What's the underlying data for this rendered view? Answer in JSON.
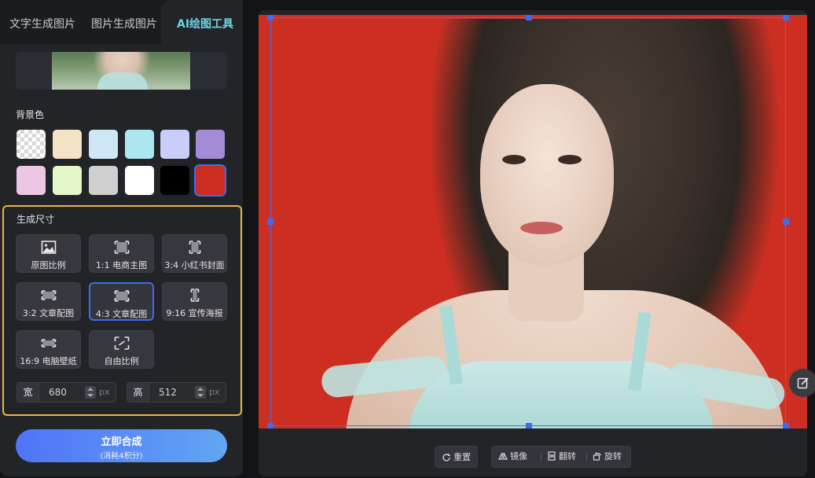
{
  "tabs": [
    {
      "label": "文字生成图片"
    },
    {
      "label": "图片生成图片"
    },
    {
      "label": "AI绘图工具"
    }
  ],
  "background_color": {
    "label": "背景色",
    "swatches": [
      {
        "name": "transparent",
        "color": "transparent"
      },
      {
        "name": "cream",
        "color": "#f3e2c4"
      },
      {
        "name": "light-blue",
        "color": "#cfe6f6"
      },
      {
        "name": "cyan",
        "color": "#ace6ef"
      },
      {
        "name": "lavender",
        "color": "#c8cdfa"
      },
      {
        "name": "purple",
        "color": "#a38bd6"
      },
      {
        "name": "pink",
        "color": "#ecc7e5"
      },
      {
        "name": "light-green",
        "color": "#e3f7c9"
      },
      {
        "name": "gray",
        "color": "#cfcfd0"
      },
      {
        "name": "white",
        "color": "#ffffff"
      },
      {
        "name": "black",
        "color": "#000000"
      },
      {
        "name": "red",
        "color": "#cc2f22",
        "selected": true
      }
    ]
  },
  "generate_size": {
    "label": "生成尺寸",
    "options": [
      {
        "label": "原图比例",
        "icon": "image-icon"
      },
      {
        "label": "1:1 电商主图",
        "icon": "ratio-square-icon"
      },
      {
        "label": "3:4 小红书封面",
        "icon": "ratio-portrait-icon"
      },
      {
        "label": "3:2 文章配图",
        "icon": "ratio-landscape-icon"
      },
      {
        "label": "4:3 文章配图",
        "icon": "ratio-landscape-icon",
        "selected": true
      },
      {
        "label": "9:16 宣传海报",
        "icon": "ratio-tall-icon"
      },
      {
        "label": "16:9 电脑壁纸",
        "icon": "ratio-wide-icon"
      },
      {
        "label": "自由比例",
        "icon": "free-crop-icon"
      }
    ],
    "width": {
      "label": "宽",
      "value": "680",
      "unit": "px"
    },
    "height": {
      "label": "高",
      "value": "512",
      "unit": "px"
    }
  },
  "cta": {
    "label": "立即合成",
    "sublabel": "(消耗4积分)"
  },
  "accent_color": "#3d6cf4",
  "highlight_color": "#e9b545",
  "toolbar": {
    "reset": "重置",
    "mirror": "镜像",
    "flip": "翻转",
    "rotate": "旋转"
  }
}
